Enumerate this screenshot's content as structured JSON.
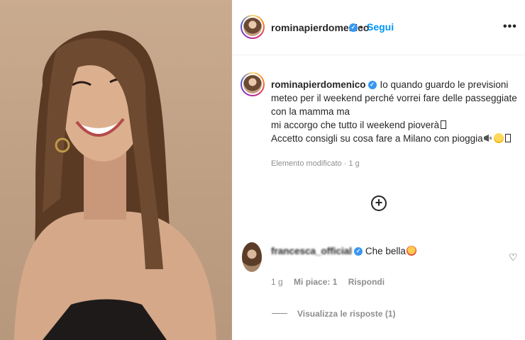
{
  "post": {
    "author": "rominapierdomenico",
    "follow_label": "Segui",
    "separator": "•",
    "more_icon": "•••",
    "caption_lines": [
      "Io quando guardo le previsioni meteo per",
      "il weekend perché vorrei fare delle passeggiate con la mamma ma",
      "mi accorgo che tutto il weekend pioverà",
      "Accetto consigli su cosa fare a Milano con pioggia"
    ],
    "caption_meta": "Elemento modificato · 1 g",
    "load_more_icon": "+"
  },
  "comment": {
    "author": "francesca_official",
    "text": "Che bella",
    "time": "1 g",
    "likes": "Mi piace: 1",
    "reply_label": "Rispondi",
    "view_replies": "Visualizza le risposte (1)"
  },
  "colors": {
    "link_blue": "#0095f6",
    "verified_blue": "#3897f0",
    "muted_text": "#8e8e8e",
    "photo_background": "#c9ab8f"
  },
  "icons": {
    "verified": "verified-badge-icon",
    "plus": "plus-circle-icon",
    "heart": "heart-outline-icon",
    "more": "more-horizontal-icon"
  }
}
